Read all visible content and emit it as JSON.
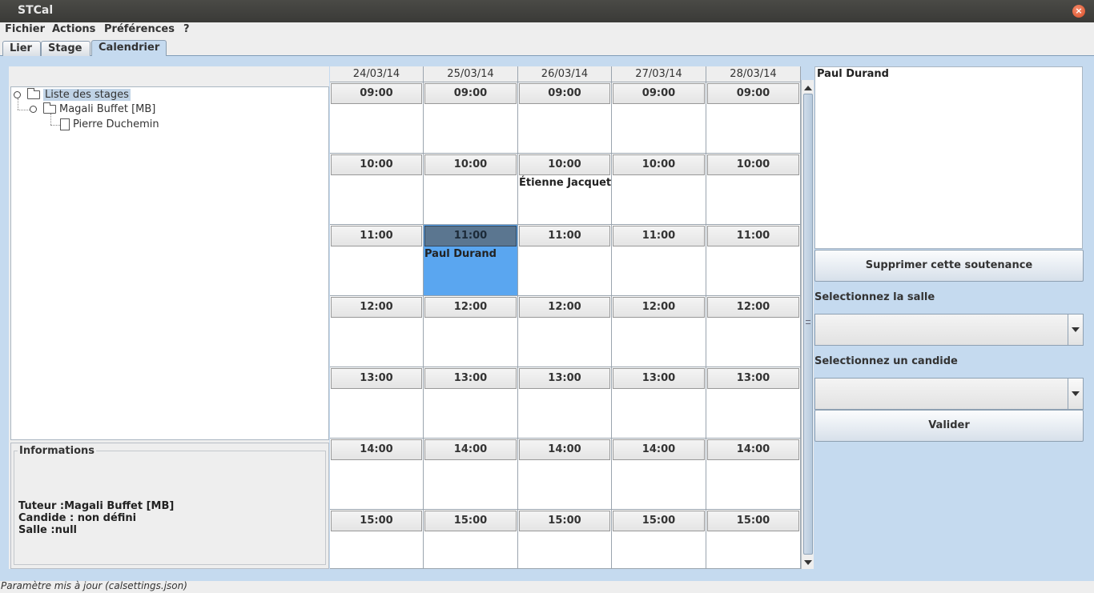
{
  "window": {
    "title": "STCal",
    "close_glyph": "×"
  },
  "menu": [
    "Fichier",
    "Actions",
    "Préférences",
    "?"
  ],
  "tabs": [
    {
      "label": "Lier",
      "active": false
    },
    {
      "label": "Stage",
      "active": false
    },
    {
      "label": "Calendrier",
      "active": true
    }
  ],
  "tree": {
    "root": "Liste des stages",
    "child": "Magali Buffet [MB]",
    "leaf": "Pierre Duchemin"
  },
  "info": {
    "legend": "Informations",
    "tuteur": "Tuteur :Magali Buffet [MB]",
    "candide": "Candide : non défini",
    "salle": "Salle :null"
  },
  "calendar": {
    "days": [
      "24/03/14",
      "25/03/14",
      "26/03/14",
      "27/03/14",
      "28/03/14"
    ],
    "hours": [
      "09:00",
      "10:00",
      "11:00",
      "12:00",
      "13:00",
      "14:00",
      "15:00"
    ],
    "events": [
      {
        "day": 2,
        "hour": 1,
        "text": "Étienne Jacquet",
        "selected": false
      },
      {
        "day": 1,
        "hour": 2,
        "text": "Paul Durand",
        "selected": true
      }
    ]
  },
  "details": {
    "selected_name": "Paul Durand",
    "delete_button": "Supprimer cette soutenance",
    "room_label": "Selectionnez la salle",
    "room_value": "",
    "candide_label": "Selectionnez un candide",
    "candide_value": "",
    "validate_button": "Valider"
  },
  "status": "Paramètre mis à jour (calsettings.json)",
  "colors": {
    "accent": "#c5daef",
    "selected_cell": "#5aa6f0",
    "selected_hour": "#5b7690"
  }
}
